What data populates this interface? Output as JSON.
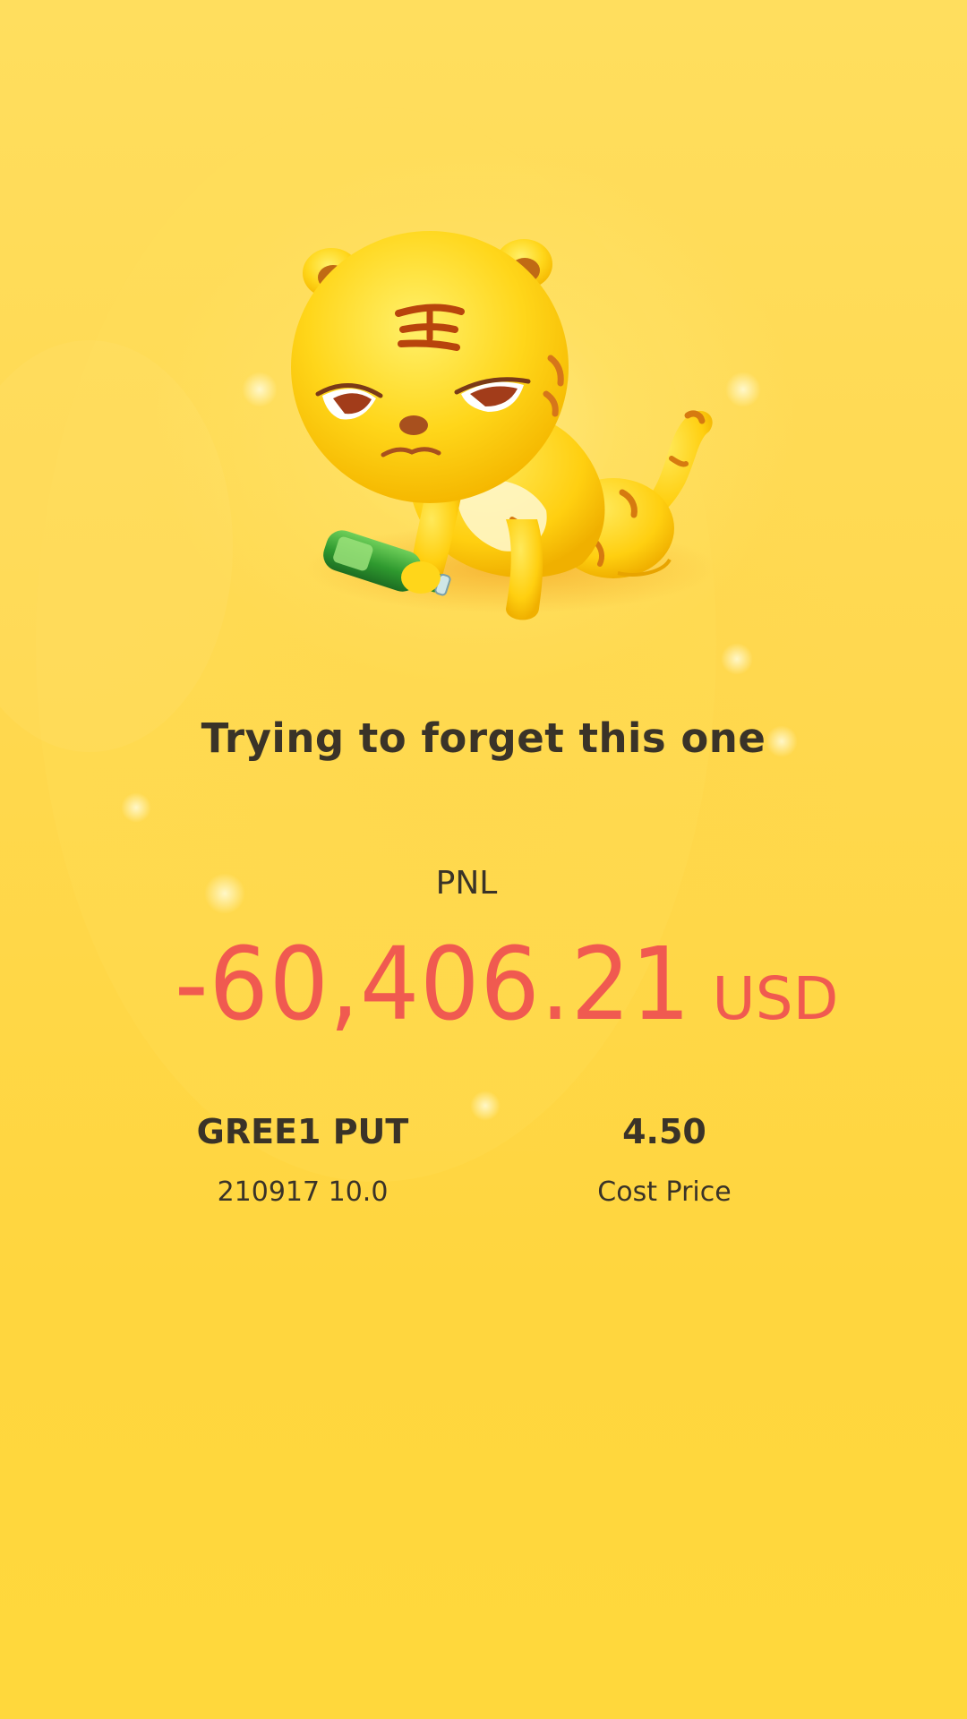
{
  "headline": "Trying to forget this one",
  "pnl": {
    "label": "PNL",
    "value": "-60,406.21",
    "unit": "USD",
    "color": "#f05a50"
  },
  "position": {
    "name": "GREE1 PUT",
    "contract": "210917 10.0"
  },
  "cost": {
    "value": "4.50",
    "label": "Cost Price"
  },
  "illustration": {
    "icon": "sad-tiger-mascot-with-bottle"
  },
  "colors": {
    "background": "#ffd84f",
    "text": "#3a3328"
  }
}
